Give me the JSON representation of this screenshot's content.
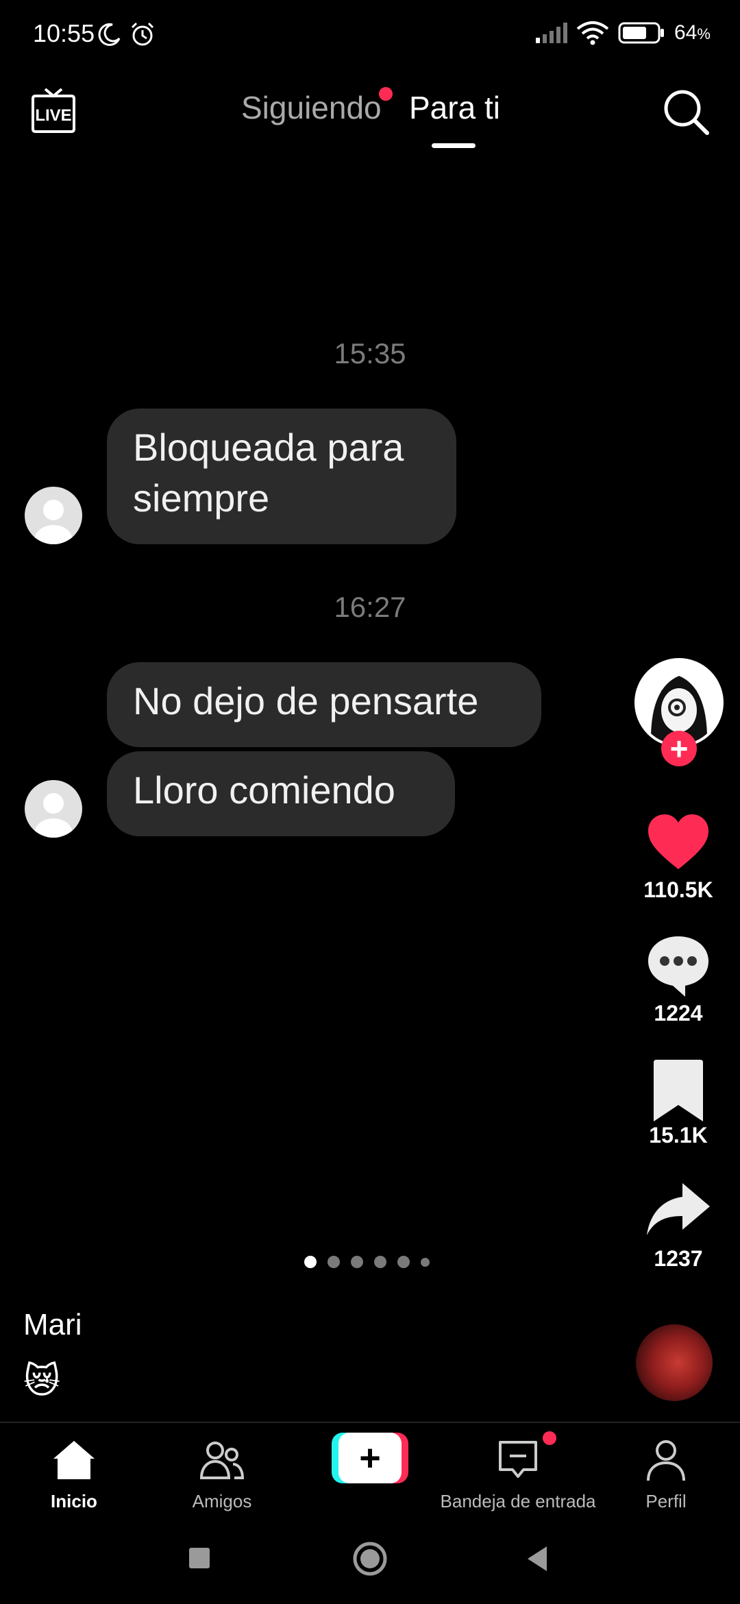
{
  "status_bar": {
    "time": "10:55",
    "battery": "64",
    "battery_unit": "%",
    "icons": [
      "moon-icon",
      "alarm-icon",
      "signal-icon",
      "wifi-icon",
      "battery-icon"
    ]
  },
  "top_nav": {
    "live_icon": "live-tv-icon",
    "tabs": [
      {
        "label": "Siguiendo",
        "has_dot": true
      },
      {
        "label": "Para ti",
        "active": true
      }
    ],
    "search_icon": "search-icon"
  },
  "chat": {
    "timestamps": [
      "15:35",
      "16:27"
    ],
    "messages": [
      {
        "text_line1": "Bloqueada para",
        "text_line2": "siempre"
      },
      {
        "text": "No dejo de pensarte"
      },
      {
        "text": "Lloro comiendo"
      }
    ]
  },
  "rail": {
    "likes": "110.5K",
    "comments": "1224",
    "saves": "15.1K",
    "shares": "1237",
    "accent": "#fe2c55"
  },
  "carousel": {
    "pages": 6,
    "current": 1
  },
  "caption": {
    "author": "Mari",
    "emoji": "😿"
  },
  "bottom_nav": {
    "items": [
      {
        "label": "Inicio",
        "icon": "home-icon",
        "active": true
      },
      {
        "label": "Amigos",
        "icon": "friends-icon"
      },
      {
        "label": "",
        "icon": "plus-icon"
      },
      {
        "label": "Bandeja de entrada",
        "icon": "inbox-icon",
        "has_dot": true
      },
      {
        "label": "Perfil",
        "icon": "profile-icon"
      }
    ]
  },
  "system_nav": {
    "icons": [
      "recents-icon",
      "home-circle-icon",
      "back-icon"
    ]
  }
}
